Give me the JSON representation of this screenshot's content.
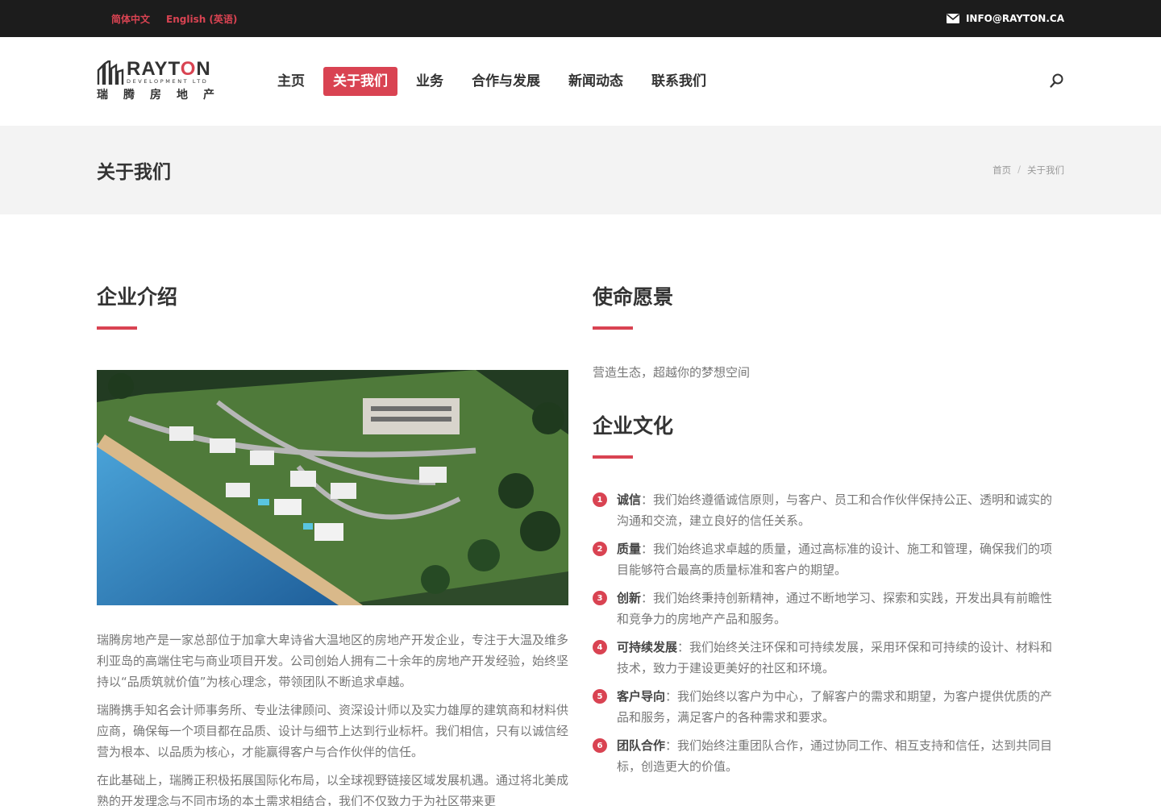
{
  "topbar": {
    "lang_zh": "简体中文",
    "lang_en": "English (英语)",
    "email": "INFO@RAYTON.CA"
  },
  "logo": {
    "name_prefix": "RAYT",
    "name_o": "O",
    "name_suffix": "N",
    "sub": "DEVELOPMENT LTD",
    "cn": "瑞腾房地产"
  },
  "nav": {
    "items": [
      {
        "label": "主页"
      },
      {
        "label": "关于我们"
      },
      {
        "label": "业务"
      },
      {
        "label": "合作与发展"
      },
      {
        "label": "新闻动态"
      },
      {
        "label": "联系我们"
      }
    ],
    "active_index": 1
  },
  "titlebar": {
    "title": "关于我们",
    "crumb_home": "首页",
    "crumb_sep": "/",
    "crumb_current": "关于我们"
  },
  "intro": {
    "heading": "企业介绍",
    "paragraphs": [
      "瑞腾房地产是一家总部位于加拿大卑诗省大温地区的房地产开发企业，专注于大温及维多利亚岛的高端住宅与商业项目开发。公司创始人拥有二十余年的房地产开发经验，始终坚持以“品质筑就价值”为核心理念，带领团队不断追求卓越。",
      "瑞腾携手知名会计师事务所、专业法律顾问、资深设计师以及实力雄厚的建筑商和材料供应商，确保每一个项目都在品质、设计与细节上达到行业标杆。我们相信，只有以诚信经营为根本、以品质为核心，才能赢得客户与合作伙伴的信任。",
      "在此基础上，瑞腾正积极拓展国际化布局，以全球视野链接区域发展机遇。通过将北美成熟的开发理念与不同市场的本土需求相结合，我们不仅致力于为社区带来更"
    ]
  },
  "mission": {
    "heading": "使命愿景",
    "text": "营造生态，超越你的梦想空间"
  },
  "culture": {
    "heading": "企业文化",
    "items": [
      {
        "num": "1",
        "title": "诚信",
        "text": "：我们始终遵循诚信原则，与客户、员工和合作伙伴保持公正、透明和诚实的沟通和交流，建立良好的信任关系。"
      },
      {
        "num": "2",
        "title": "质量",
        "text": "：我们始终追求卓越的质量，通过高标准的设计、施工和管理，确保我们的项目能够符合最高的质量标准和客户的期望。"
      },
      {
        "num": "3",
        "title": "创新",
        "text": "：我们始终秉持创新精神，通过不断地学习、探索和实践，开发出具有前瞻性和竞争力的房地产产品和服务。"
      },
      {
        "num": "4",
        "title": "可持续发展",
        "text": "：我们始终关注环保和可持续发展，采用环保和可持续的设计、材料和技术，致力于建设更美好的社区和环境。"
      },
      {
        "num": "5",
        "title": "客户导向",
        "text": "：我们始终以客户为中心，了解客户的需求和期望，为客户提供优质的产品和服务，满足客户的各种需求和要求。"
      },
      {
        "num": "6",
        "title": "团队合作",
        "text": "：我们始终注重团队合作，通过协同工作、相互支持和信任，达到共同目标，创造更大的价值。"
      }
    ]
  },
  "colors": {
    "accent": "#d94352",
    "topbar_bg": "#1c1c1c",
    "titlebar_bg": "#f3f3f3"
  }
}
